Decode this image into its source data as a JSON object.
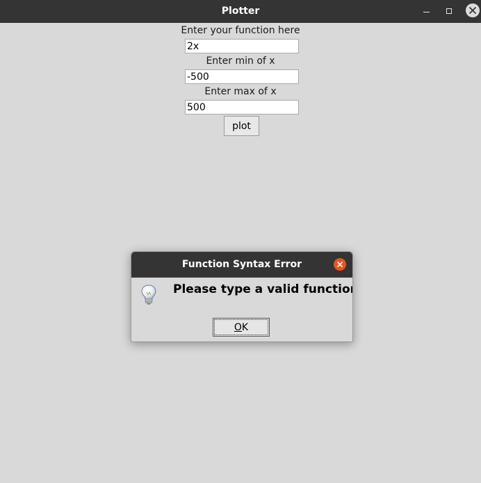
{
  "window": {
    "title": "Plotter"
  },
  "form": {
    "function_label": "Enter your function here",
    "function_value": "2x",
    "min_label": "Enter min of x",
    "min_value": "-500",
    "max_label": "Enter max of x",
    "max_value": "500",
    "plot_button": "plot"
  },
  "dialog": {
    "title": "Function Syntax Error",
    "message": "Please type a valid function",
    "ok_mnemonic": "O",
    "ok_rest": "K",
    "icon": "lightbulb-icon"
  },
  "colors": {
    "titlebar": "#343434",
    "background": "#d9d9d9",
    "dialog_close": "#e95420"
  }
}
